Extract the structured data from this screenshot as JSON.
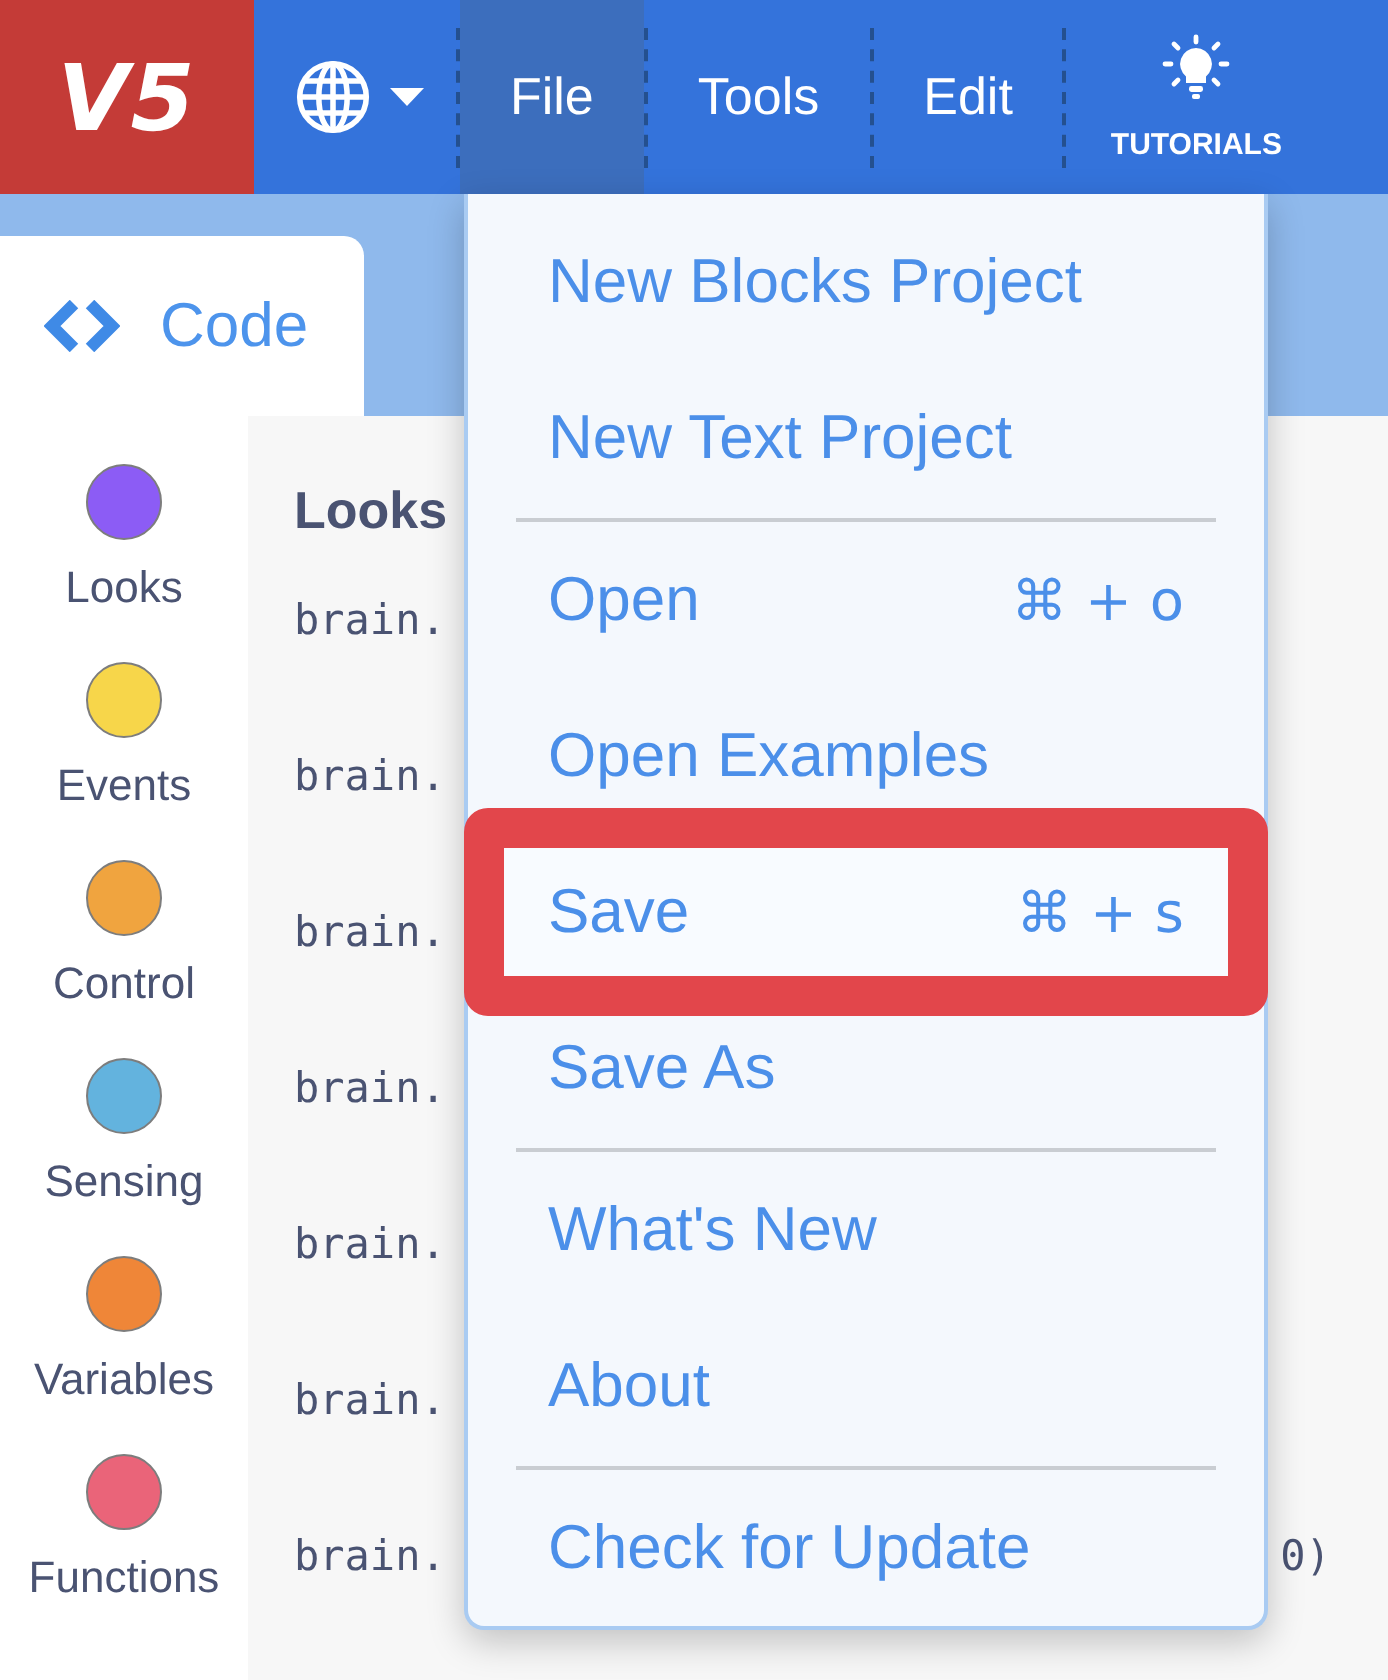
{
  "topbar": {
    "logo": "V5",
    "menus": [
      {
        "label": "File",
        "selected": true
      },
      {
        "label": "Tools",
        "selected": false
      },
      {
        "label": "Edit",
        "selected": false
      }
    ],
    "tutorials": {
      "label": "TUTORIALS"
    }
  },
  "tabs": [
    {
      "label": "Code",
      "selected": true
    }
  ],
  "categories": [
    {
      "label": "Looks",
      "color": "#8c5cf5"
    },
    {
      "label": "Events",
      "color": "#f7d64a"
    },
    {
      "label": "Control",
      "color": "#f0a43f"
    },
    {
      "label": "Sensing",
      "color": "#63b3de"
    },
    {
      "label": "Variables",
      "color": "#ef8638"
    },
    {
      "label": "Functions",
      "color": "#ea6479"
    }
  ],
  "code": {
    "heading": "Looks",
    "lines": [
      {
        "text": "brain."
      },
      {
        "text": "brain."
      },
      {
        "text": "brain."
      },
      {
        "text": "brain."
      },
      {
        "text": "brain."
      },
      {
        "text": "brain."
      },
      {
        "text": "brain.",
        "tail": "0)"
      }
    ]
  },
  "file_menu": {
    "items": [
      {
        "kind": "item",
        "label": "New Blocks Project",
        "highlighted": false
      },
      {
        "kind": "item",
        "label": "New Text Project",
        "highlighted": false
      },
      {
        "kind": "divider"
      },
      {
        "kind": "item",
        "label": "Open",
        "shortcut": "⌘ + o",
        "highlighted": false
      },
      {
        "kind": "item",
        "label": "Open Examples",
        "highlighted": false
      },
      {
        "kind": "item",
        "label": "Save",
        "shortcut": "⌘ + s",
        "highlighted": true
      },
      {
        "kind": "item",
        "label": "Save As",
        "highlighted": false
      },
      {
        "kind": "divider"
      },
      {
        "kind": "item",
        "label": "What's New",
        "highlighted": false
      },
      {
        "kind": "item",
        "label": "About",
        "highlighted": false
      },
      {
        "kind": "divider"
      },
      {
        "kind": "item",
        "label": "Check for Update",
        "highlighted": false
      }
    ]
  }
}
